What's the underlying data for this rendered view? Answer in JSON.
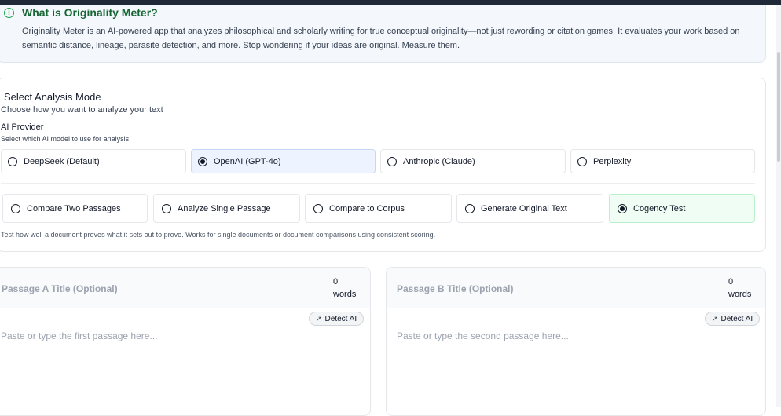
{
  "info": {
    "icon": "info-icon",
    "title": "What is Originality Meter?",
    "text": "Originality Meter is an AI-powered app that analyzes philosophical and scholarly writing for true conceptual originality—not just rewording or citation games. It evaluates your work based on semantic distance, lineage, parasite detection, and more. Stop wondering if your ideas are original. Measure them."
  },
  "mode": {
    "heading": "Select Analysis Mode",
    "subheading": "Choose how you want to analyze your text",
    "provider_heading": "AI Provider",
    "provider_subheading": "Select which AI model to use for analysis",
    "providers": [
      "DeepSeek (Default)",
      "OpenAI (GPT-4o)",
      "Anthropic (Claude)",
      "Perplexity"
    ],
    "selected_provider": "OpenAI (GPT-4o)",
    "modes": [
      "Compare Two Passages",
      "Analyze Single Passage",
      "Compare to Corpus",
      "Generate Original Text",
      "Cogency Test"
    ],
    "selected_mode": "Cogency Test",
    "mode_description": "Test how well a document proves what it sets out to prove. Works for single documents or document comparisons using consistent scoring."
  },
  "passages": {
    "a": {
      "title_placeholder": "Passage A Title (Optional)",
      "count": "0",
      "count_unit": "words",
      "detect_label": "Detect AI",
      "text_placeholder": "Paste or type the first passage here..."
    },
    "b": {
      "title_placeholder": "Passage B Title (Optional)",
      "count": "0",
      "count_unit": "words",
      "detect_label": "Detect AI",
      "text_placeholder": "Paste or type the second passage here..."
    }
  },
  "colors": {
    "accent_green": "#166534",
    "selected_blue": "#eef4ff",
    "selected_green": "#f0fdf4"
  }
}
